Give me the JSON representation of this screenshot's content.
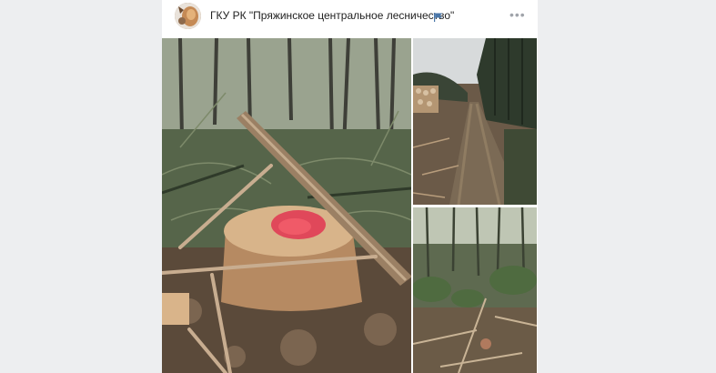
{
  "post": {
    "group_name": "ГКУ РК \"Пряжинское центральное лесничество\"",
    "icons": {
      "flag": "flag-icon",
      "more": "more-icon"
    },
    "more_label": "•••"
  },
  "colors": {
    "background": "#edeef0",
    "card": "#ffffff",
    "flag_blue": "#4a76a8"
  }
}
